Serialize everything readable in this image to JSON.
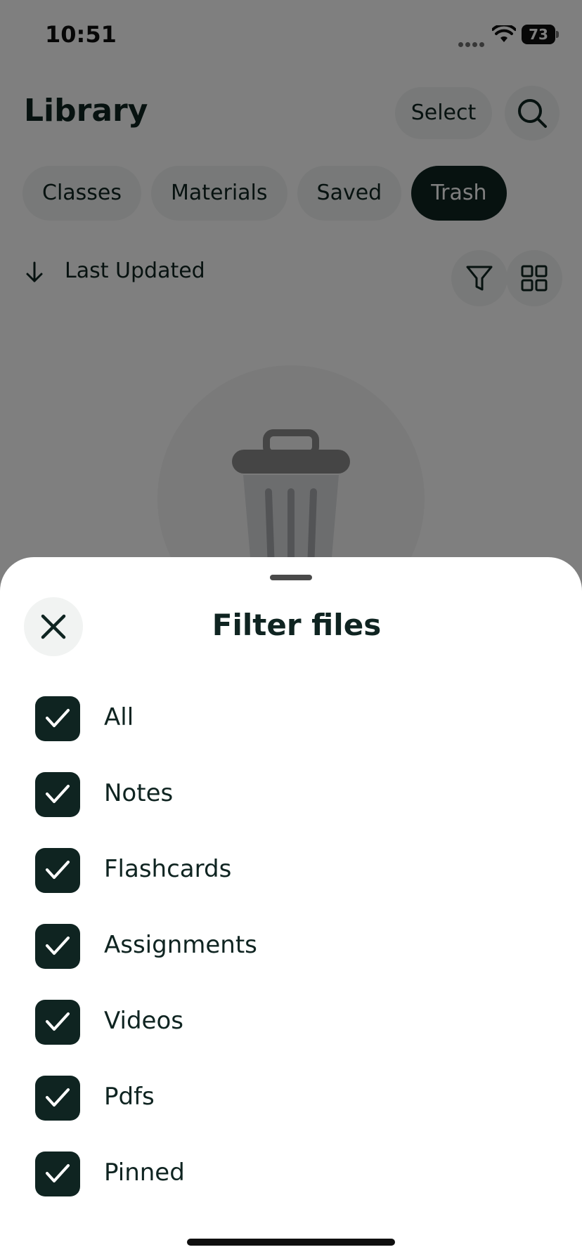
{
  "status_bar": {
    "time": "10:51",
    "battery": "73"
  },
  "header": {
    "title": "Library",
    "select_label": "Select"
  },
  "tabs": [
    {
      "label": "Classes",
      "active": false
    },
    {
      "label": "Materials",
      "active": false
    },
    {
      "label": "Saved",
      "active": false
    },
    {
      "label": "Trash",
      "active": true
    }
  ],
  "sort": {
    "label": "Last Updated"
  },
  "icons": {
    "search": "search-icon",
    "filter": "filter-icon",
    "grid": "grid-view-icon",
    "sort": "arrow-down-icon",
    "trash": "trash-can-icon",
    "close": "close-icon",
    "check": "checkmark-icon"
  },
  "filter_sheet": {
    "title": "Filter files",
    "options": [
      {
        "label": "All",
        "checked": true
      },
      {
        "label": "Notes",
        "checked": true
      },
      {
        "label": "Flashcards",
        "checked": true
      },
      {
        "label": "Assignments",
        "checked": true
      },
      {
        "label": "Videos",
        "checked": true
      },
      {
        "label": "Pdfs",
        "checked": true
      },
      {
        "label": "Pinned",
        "checked": true
      }
    ]
  },
  "colors": {
    "primary_dark": "#0f2421",
    "chip_bg": "#f1f3f2",
    "overlay": "rgba(0,0,0,0.5)",
    "sheet_bg": "#ffffff"
  }
}
